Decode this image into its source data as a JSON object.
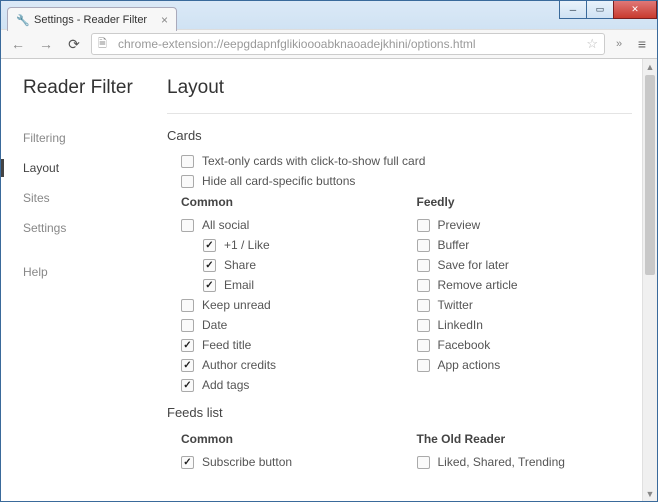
{
  "window": {
    "tab_title": "Settings - Reader Filter"
  },
  "toolbar": {
    "url": "chrome-extension://eepgdapnfglikioooabknaoadejkhini/options.html"
  },
  "sidebar": {
    "app_title": "Reader Filter",
    "items": [
      {
        "label": "Filtering",
        "active": false
      },
      {
        "label": "Layout",
        "active": true
      },
      {
        "label": "Sites",
        "active": false
      },
      {
        "label": "Settings",
        "active": false
      }
    ],
    "help": {
      "label": "Help"
    }
  },
  "page": {
    "title": "Layout",
    "sections": {
      "cards": {
        "title": "Cards",
        "top_opts": [
          {
            "label": "Text-only cards with click-to-show full card",
            "checked": false
          },
          {
            "label": "Hide all card-specific buttons",
            "checked": false
          }
        ],
        "common": {
          "title": "Common",
          "items": [
            {
              "label": "All social",
              "checked": false,
              "c": [
                {
                  "label": "+1 / Like",
                  "checked": true
                },
                {
                  "label": "Share",
                  "checked": true
                },
                {
                  "label": "Email",
                  "checked": true
                }
              ]
            },
            {
              "label": "Keep unread",
              "checked": false
            },
            {
              "label": "Date",
              "checked": false
            },
            {
              "label": "Feed title",
              "checked": true
            },
            {
              "label": "Author credits",
              "checked": true
            },
            {
              "label": "Add tags",
              "checked": true
            }
          ]
        },
        "feedly": {
          "title": "Feedly",
          "items": [
            {
              "label": "Preview",
              "checked": false
            },
            {
              "label": "Buffer",
              "checked": false
            },
            {
              "label": "Save for later",
              "checked": false
            },
            {
              "label": "Remove article",
              "checked": false
            },
            {
              "label": "Twitter",
              "checked": false
            },
            {
              "label": "LinkedIn",
              "checked": false
            },
            {
              "label": "Facebook",
              "checked": false
            },
            {
              "label": "App actions",
              "checked": false
            }
          ]
        }
      },
      "feeds": {
        "title": "Feeds list",
        "common": {
          "title": "Common",
          "items": [
            {
              "label": "Subscribe button",
              "checked": true
            }
          ]
        },
        "oldreader": {
          "title": "The Old Reader",
          "items": [
            {
              "label": "Liked, Shared, Trending",
              "checked": false
            }
          ]
        }
      }
    }
  }
}
